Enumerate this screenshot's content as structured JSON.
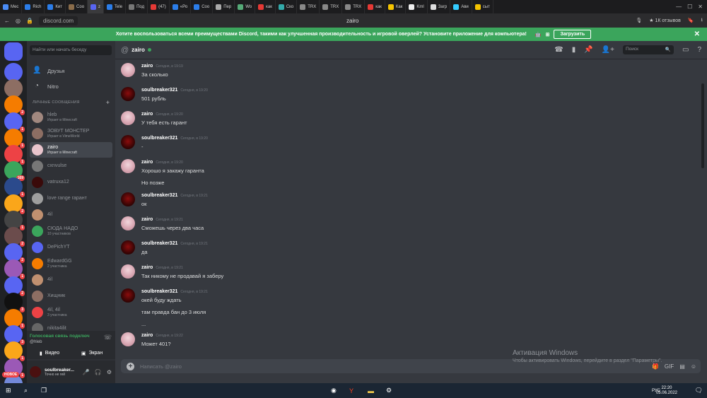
{
  "browser": {
    "tabs": [
      "Мес",
      "Rich",
      "Кит",
      "Соо",
      "z",
      "Tele",
      "Под",
      "(47)",
      "«Ро",
      "Соо",
      "Пер",
      "Wo",
      "как",
      "Ско",
      "TRX",
      "TRX",
      "TRX",
      "как",
      "Как",
      "Kml",
      "Загр",
      "Ави",
      "сыт"
    ],
    "address": "discord.com",
    "page_title": "zairo",
    "reviews": "1К отзывов"
  },
  "banner": {
    "text": "Хотите воспользоваться всеми преимуществами Discord, такими как улучшенная производительность и игровой оверлей? Установите приложение для компьютера!",
    "button": "Загрузить"
  },
  "guilds": [
    {
      "badge": ""
    },
    {
      "badge": ""
    },
    {
      "badge": "2"
    },
    {
      "badge": "1"
    },
    {
      "badge": "1"
    },
    {
      "badge": "1"
    },
    {
      "badge": "169"
    },
    {
      "badge": "1"
    },
    {
      "badge": "2"
    },
    {
      "badge": "1"
    },
    {
      "badge": "2"
    },
    {
      "badge": "2"
    },
    {
      "badge": "1"
    },
    {
      "badge": "2"
    },
    {
      "badge": "3"
    },
    {
      "badge": "1"
    },
    {
      "badge": "3"
    },
    {
      "badge": "1"
    },
    {
      "badge": "1"
    },
    {
      "badge": "2"
    }
  ],
  "guild_new_label": "НОВОЕ",
  "dm_sidebar": {
    "search_placeholder": "Найти или начать беседу",
    "friends": "Друзья",
    "nitro": "Nitro",
    "header": "ЛИЧНЫЕ СООБЩЕНИЯ",
    "dms": [
      {
        "name": "hleb",
        "status": "Играет в Minecraft"
      },
      {
        "name": "ЗОВУТ МОНСТЕР",
        "status": "Играет в VimeWorld"
      },
      {
        "name": "zairo",
        "status": "Играет в Minecraft"
      },
      {
        "name": "cxnvulse",
        "status": ""
      },
      {
        "name": "vatruxa12",
        "status": ""
      },
      {
        "name": "love range гарант",
        "status": ""
      },
      {
        "name": "4il",
        "status": ""
      },
      {
        "name": "СЮДА НАДО",
        "status": "10 участников"
      },
      {
        "name": "DePichYT",
        "status": ""
      },
      {
        "name": "EdwardGG",
        "status": "2 участника"
      },
      {
        "name": "4il",
        "status": ""
      },
      {
        "name": "Хищник",
        "status": ""
      },
      {
        "name": "4il, 4il",
        "status": "3 участника"
      },
      {
        "name": "nikita4ilit",
        "status": ""
      }
    ],
    "voice_status": "Голосовая связь подключ",
    "voice_channel": "@hleb",
    "video_label": "Видео",
    "screen_label": "Экран",
    "user_name": "soulbreaker...",
    "user_status": "Точно не гей"
  },
  "chat": {
    "channel": "zairo",
    "search_placeholder": "Поиск",
    "composer_placeholder": "Написать @zairo",
    "messages": [
      {
        "author": "zairo",
        "time": "Сегодня, в 19:19",
        "lines": [
          "За сколько"
        ],
        "avatar": "z"
      },
      {
        "author": "soulbreaker321",
        "time": "Сегодня, в 19:20",
        "lines": [
          "501 рубль"
        ],
        "avatar": "s"
      },
      {
        "author": "zairo",
        "time": "Сегодня, в 19:20",
        "lines": [
          "У тебя есть гарант"
        ],
        "avatar": "z"
      },
      {
        "author": "soulbreaker321",
        "time": "Сегодня, в 19:20",
        "lines": [
          "-"
        ],
        "avatar": "s"
      },
      {
        "author": "zairo",
        "time": "Сегодня, в 19:20",
        "lines": [
          "Хорошо я закажу гаранта",
          "Но позже"
        ],
        "avatar": "z"
      },
      {
        "author": "soulbreaker321",
        "time": "Сегодня, в 19:21",
        "lines": [
          "ок"
        ],
        "avatar": "s"
      },
      {
        "author": "zairo",
        "time": "Сегодня, в 19:21",
        "lines": [
          "Сможешь через два часа"
        ],
        "avatar": "z"
      },
      {
        "author": "soulbreaker321",
        "time": "Сегодня, в 19:21",
        "lines": [
          "да"
        ],
        "avatar": "s"
      },
      {
        "author": "zairo",
        "time": "Сегодня, в 19:21",
        "lines": [
          "Так никому не продавай я заберу"
        ],
        "avatar": "z"
      },
      {
        "author": "soulbreaker321",
        "time": "Сегодня, в 19:21",
        "lines": [
          "окей буду ждать",
          "там правда бан до 3 июля",
          "..."
        ],
        "avatar": "s"
      },
      {
        "author": "zairo",
        "time": "Сегодня, в 19:22",
        "lines": [
          "Может 401?"
        ],
        "avatar": "z"
      }
    ]
  },
  "watermark": {
    "title": "Активация Windows",
    "text": "Чтобы активировать Windows, перейдите в раздел \"Параметры\"."
  },
  "taskbar": {
    "lang": "РУС",
    "time": "22:20",
    "date": "05.06.2022"
  }
}
